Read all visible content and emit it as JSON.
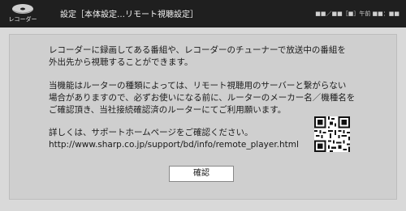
{
  "header": {
    "logo_label": "レコーダー",
    "title": "設定［本体設定…リモート視聴設定］",
    "datetime": "■■／■■［■］午前 ■■：■■"
  },
  "message": {
    "paragraph1": [
      "レコーダーに録画してある番組や、レコーダーのチューナーで放送中の番組を",
      "外出先から視聴することができます。"
    ],
    "paragraph2": [
      "当機能はルーターの種類によっては、リモート視聴用のサーバーと繋がらない",
      "場合がありますので、必ずお使いになる前に、ルーターのメーカー名／機種名を",
      "ご確認頂き、当社接続確認済のルーターにてご利用願います。"
    ],
    "paragraph3": [
      "詳しくは、サポートホームページをご確認ください。",
      "http://www.sharp.co.jp/support/bd/info/remote_player.html"
    ]
  },
  "qr_icon": "qr-code-icon",
  "confirm_button": "確認"
}
